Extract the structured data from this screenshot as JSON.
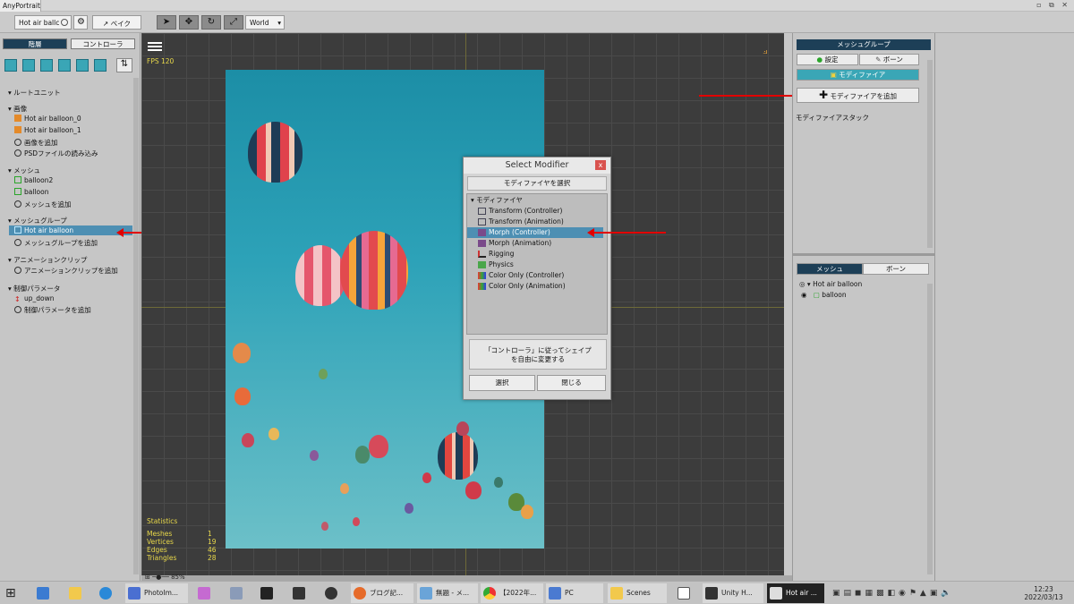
{
  "app": {
    "title": "AnyPortrait",
    "window_controls": "▫ ⧉ ✕"
  },
  "toolbar": {
    "mesh_select": "Hot air ballc",
    "bake": "ベイク",
    "space": "World"
  },
  "left": {
    "tab_hierarchy": "階層",
    "tab_controller": "コントローラ",
    "root_unit": "ルートユニット",
    "images": {
      "header": "画像",
      "items": [
        "Hot air balloon_0",
        "Hot air balloon_1"
      ],
      "add": "画像を追加",
      "psd": "PSDファイルの読み込み"
    },
    "meshes": {
      "header": "メッシュ",
      "items": [
        "balloon2",
        "balloon"
      ],
      "add": "メッシュを追加"
    },
    "meshgroups": {
      "header": "メッシュグループ",
      "items": [
        "Hot air balloon"
      ],
      "add": "メッシュグループを追加"
    },
    "anim": {
      "header": "アニメーションクリップ",
      "add": "アニメーションクリップを追加"
    },
    "params": {
      "header": "制御パラメータ",
      "items": [
        "up_down"
      ],
      "add": "制御パラメータを追加"
    }
  },
  "viewport": {
    "fps": "FPS 120",
    "stats_title": "Statistics",
    "stats": [
      {
        "label": "Meshes",
        "value": "1"
      },
      {
        "label": "Vertices",
        "value": "19"
      },
      {
        "label": "Edges",
        "value": "46"
      },
      {
        "label": "Triangles",
        "value": "28"
      }
    ],
    "zoom": "85%"
  },
  "dialog": {
    "title": "Select Modifier",
    "subtitle": "モディファイヤを選択",
    "group": "モディファイヤ",
    "items": [
      "Transform (Controller)",
      "Transform (Animation)",
      "Morph (Controller)",
      "Morph (Animation)",
      "Rigging",
      "Physics",
      "Color Only (Controller)",
      "Color Only (Animation)"
    ],
    "selected_index": 2,
    "description_line1": "「コントローラ」に従ってシェイプ",
    "description_line2": "を自由に変更する",
    "select_btn": "選択",
    "close_btn": "閉じる",
    "close_x": "x"
  },
  "right": {
    "header": "メッシュグループ",
    "tab_settings": "設定",
    "tab_bone": "ボーン",
    "tab_modifier": "モディファイア",
    "add_modifier": "モディファイアを追加",
    "modifier_stack": "モディファイアスタック",
    "tab_mesh": "メッシュ",
    "tab_bone2": "ボーン",
    "tree_root": "Hot air balloon",
    "tree_child": "balloon"
  },
  "taskbar": {
    "items": [
      "PhotoIm...",
      "ブログ記...",
      "無題 - メ...",
      "【2022年...",
      "PC",
      "Scenes",
      "Unity H...",
      "Hot air ..."
    ],
    "time": "12:23",
    "date": "2022/03/13"
  },
  "colors": {
    "accent": "#3aa6b6",
    "selection": "#4d8fb3",
    "stats": "#e8d84a",
    "arrow": "#e10000"
  }
}
